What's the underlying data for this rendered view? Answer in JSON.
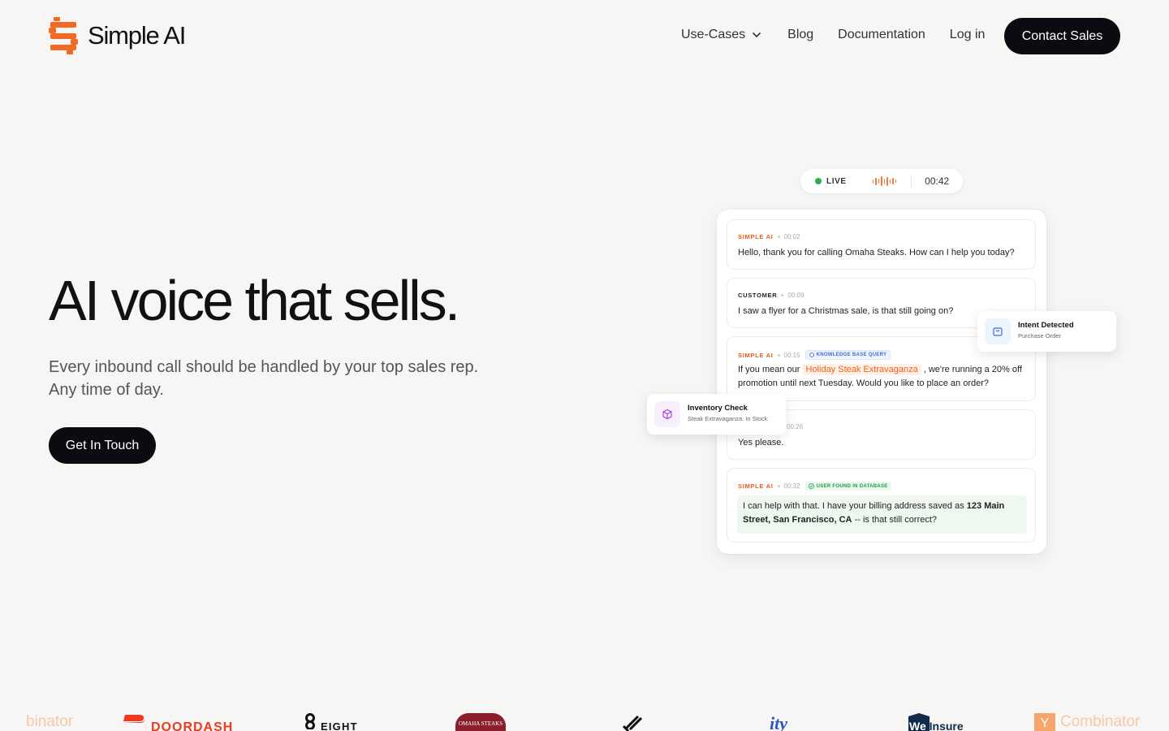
{
  "brand": {
    "name": "Simple AI",
    "accent": "#f06a25"
  },
  "nav": {
    "links": [
      {
        "label": "Use-Cases",
        "has_dropdown": true,
        "icon": "chevron-down-icon"
      },
      {
        "label": "Blog"
      },
      {
        "label": "Documentation"
      },
      {
        "label": "Log in"
      }
    ],
    "contact_label": "Contact Sales"
  },
  "hero": {
    "title": "AI voice that sells.",
    "subtitle_line1": "Every inbound call should be handled by your top sales rep.",
    "subtitle_line2": "Any time of day.",
    "cta_label": "Get In Touch"
  },
  "call": {
    "status": "LIVE",
    "status_color": "#22b14c",
    "timer": "00:42",
    "messages": [
      {
        "speaker": "SIMPLE AI",
        "time": "00:02",
        "text": "Hello, thank you for calling Omaha Steaks. How can I help you today?"
      },
      {
        "speaker": "CUSTOMER",
        "time": "00:09",
        "text": "I saw a flyer for a Christmas sale, is that still going on?"
      },
      {
        "speaker": "SIMPLE AI",
        "time": "00:15",
        "tag": "KNOWLEDGE BASE QUERY",
        "text_before": "If you mean our",
        "highlight": "Holiday Steak Extravaganza",
        "text_after": ", we're running a 20% off promotion until next Tuesday. Would you like to place an order?"
      },
      {
        "speaker": "",
        "time": "00:26",
        "text": "Yes please."
      },
      {
        "speaker": "SIMPLE AI",
        "time": "00:32",
        "tag": "USER FOUND IN DATABASE",
        "text_before": "I can help with that. I have your billing address saved as",
        "bold": "123 Main Street, San Francisco, CA",
        "text_after": "-- is that still correct?"
      }
    ]
  },
  "intent_card": {
    "title": "Intent Detected",
    "subtitle": "Purchase Order",
    "icon": "shopping-bag-icon"
  },
  "inventory_card": {
    "title": "Inventory Check",
    "subtitle": "Steak Extravaganza: In Stock",
    "icon": "box-icon"
  },
  "customer_logos": [
    {
      "text": "binator"
    },
    {
      "text": "DOORDASH"
    },
    {
      "text": "EIGHT"
    },
    {
      "text": "OMAHA STEAKS"
    },
    {
      "text": ""
    },
    {
      "text": "ity"
    },
    {
      "text": "We Insure"
    },
    {
      "text": "Combinator"
    }
  ]
}
